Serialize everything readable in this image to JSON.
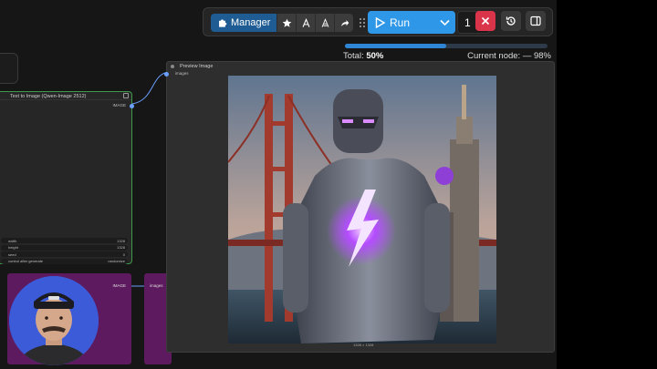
{
  "toolbar": {
    "manager_label": "Manager",
    "run_label": "Run",
    "queue_count": "1",
    "icons": [
      "puzzle-icon",
      "star-icon",
      "node-library-icon",
      "model-library-icon",
      "share-icon",
      "grip-icon",
      "play-icon",
      "chevron-down-icon",
      "x-icon",
      "history-icon",
      "sidebar-panel-icon"
    ]
  },
  "progress": {
    "total_label": "Total:",
    "total_value": "50%",
    "total_fraction": 0.5,
    "current_label": "Current node: — 98%"
  },
  "node_t2i": {
    "title": "Text to Image (Qwen-Image 2512)",
    "output_label": "IMAGE",
    "widgets": [
      {
        "name": "width",
        "value": "1328"
      },
      {
        "name": "height",
        "value": "1328"
      },
      {
        "name": "seed",
        "value": "0"
      },
      {
        "name": "control after generate",
        "value": "randomize"
      }
    ]
  },
  "node_bottom": {
    "output_label": "IMAGE",
    "input_label": "images"
  },
  "node_preview": {
    "title": "Preview Image",
    "input_label": "images",
    "footer": "1328 × 1328"
  },
  "colors": {
    "accent": "#2f97e8",
    "manager": "#1f5c93",
    "cancel": "#d9344a",
    "node_border": "#3e9a4a",
    "group": "#5e1a5e"
  }
}
